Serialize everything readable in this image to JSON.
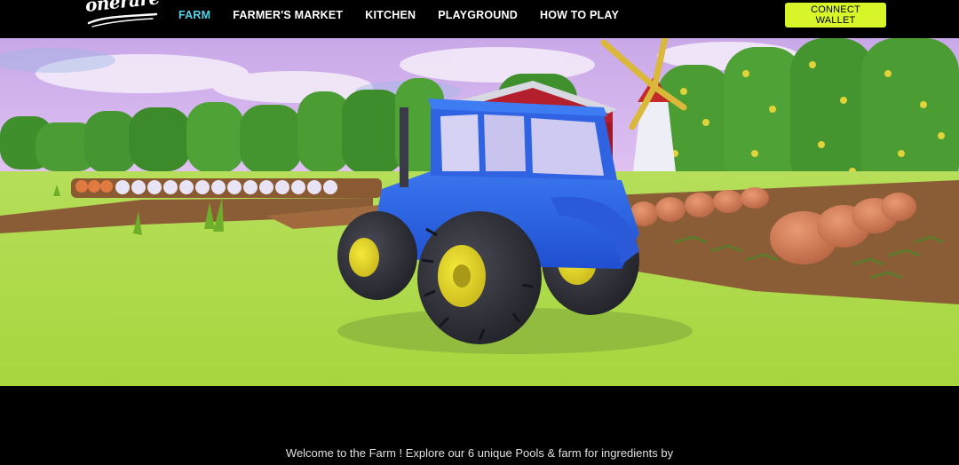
{
  "brand": {
    "logo_text": "onerare",
    "logo_icon": "onerare-logo"
  },
  "nav": {
    "items": [
      {
        "label": "FARM",
        "active": true
      },
      {
        "label": "FARMER'S MARKET",
        "active": false
      },
      {
        "label": "KITCHEN",
        "active": false
      },
      {
        "label": "PLAYGROUND",
        "active": false
      },
      {
        "label": "HOW TO PLAY",
        "active": false
      }
    ],
    "active_color": "#4fd4e8",
    "connect_label": "CONNECT WALLET",
    "connect_color": "#d8f52a"
  },
  "hero": {
    "scene": "farm-scene-with-blue-tractor"
  },
  "intro": {
    "text": "Welcome to the Farm ! Explore our 6 unique Pools & farm for ingredients by"
  }
}
